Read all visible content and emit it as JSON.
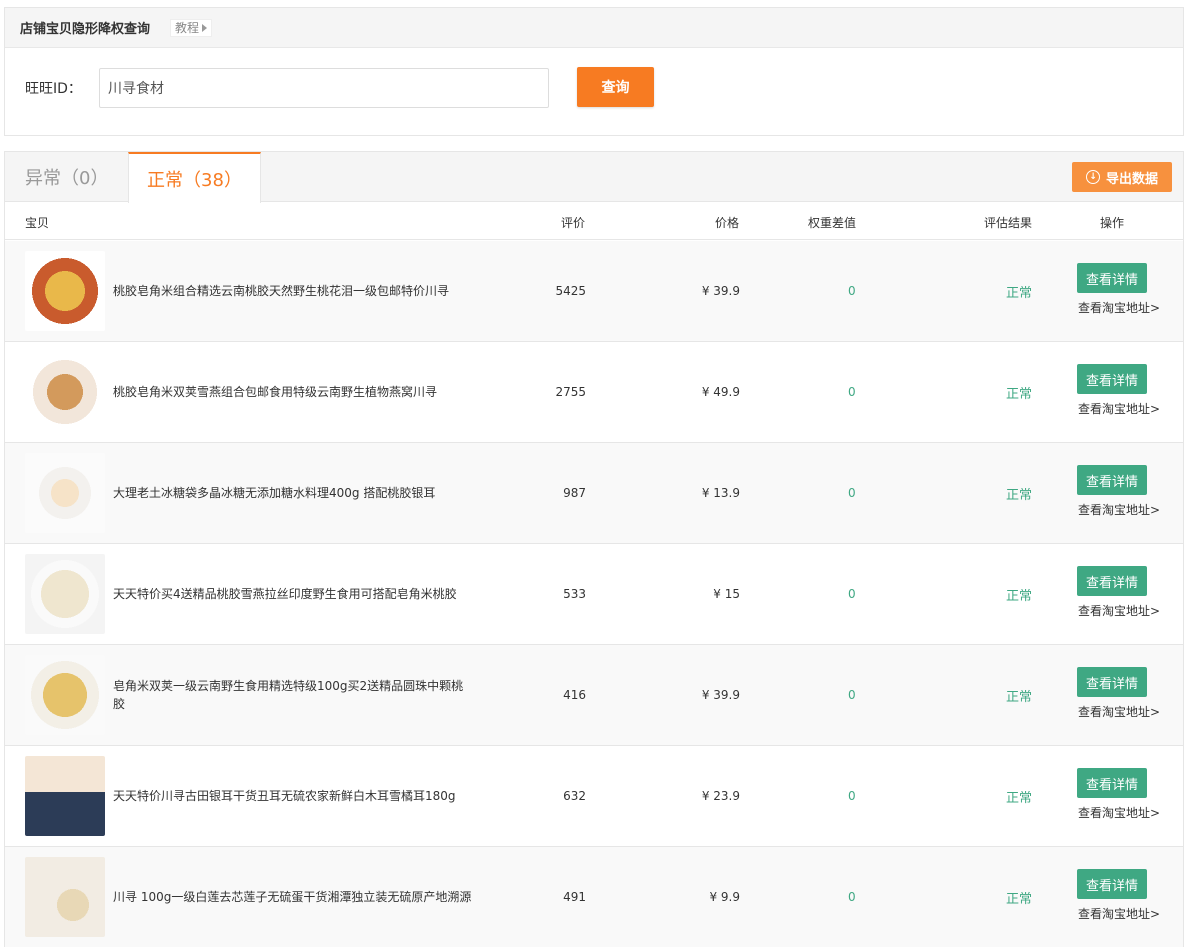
{
  "query_panel": {
    "title": "店铺宝贝隐形降权查询",
    "tutorial_label": "教程",
    "wangwang_label": "旺旺ID：",
    "wangwang_value": "川寻食材",
    "query_button": "查询"
  },
  "tabs": {
    "abnormal_label": "异常（0）",
    "normal_label": "正常（38）",
    "export_label": "导出数据"
  },
  "columns": {
    "item": "宝贝",
    "reviews": "评价",
    "price": "价格",
    "weight_diff": "权重差值",
    "result": "评估结果",
    "actions": "操作"
  },
  "actions": {
    "detail_label": "查看详情",
    "taobao_label": "查看淘宝地址>"
  },
  "colors": {
    "accent_orange": "#f77b22",
    "status_green": "#3fa883"
  },
  "rows": [
    {
      "title": "桃胶皂角米组合精选云南桃胶天然野生桃花泪一级包邮特价川寻",
      "reviews": "5425",
      "price": "¥ 39.9",
      "weight_diff": "0",
      "result": "正常"
    },
    {
      "title": "桃胶皂角米双荚雪燕组合包邮食用特级云南野生植物燕窝川寻",
      "reviews": "2755",
      "price": "¥ 49.9",
      "weight_diff": "0",
      "result": "正常"
    },
    {
      "title": "大理老土冰糖袋多晶冰糖无添加糖水料理400g 搭配桃胶银耳",
      "reviews": "987",
      "price": "¥ 13.9",
      "weight_diff": "0",
      "result": "正常"
    },
    {
      "title": "天天特价买4送精品桃胶雪燕拉丝印度野生食用可搭配皂角米桃胶",
      "reviews": "533",
      "price": "¥ 15",
      "weight_diff": "0",
      "result": "正常"
    },
    {
      "title": "皂角米双荚一级云南野生食用精选特级100g买2送精品圆珠中颗桃胶",
      "reviews": "416",
      "price": "¥ 39.9",
      "weight_diff": "0",
      "result": "正常"
    },
    {
      "title": "天天特价川寻古田银耳干货丑耳无硫农家新鲜白木耳雪橘耳180g",
      "reviews": "632",
      "price": "¥ 23.9",
      "weight_diff": "0",
      "result": "正常"
    },
    {
      "title": "川寻 100g一级白莲去芯莲子无硫蛋干货湘潭独立装无硫原产地溯源",
      "reviews": "491",
      "price": "¥ 9.9",
      "weight_diff": "0",
      "result": "正常"
    }
  ]
}
